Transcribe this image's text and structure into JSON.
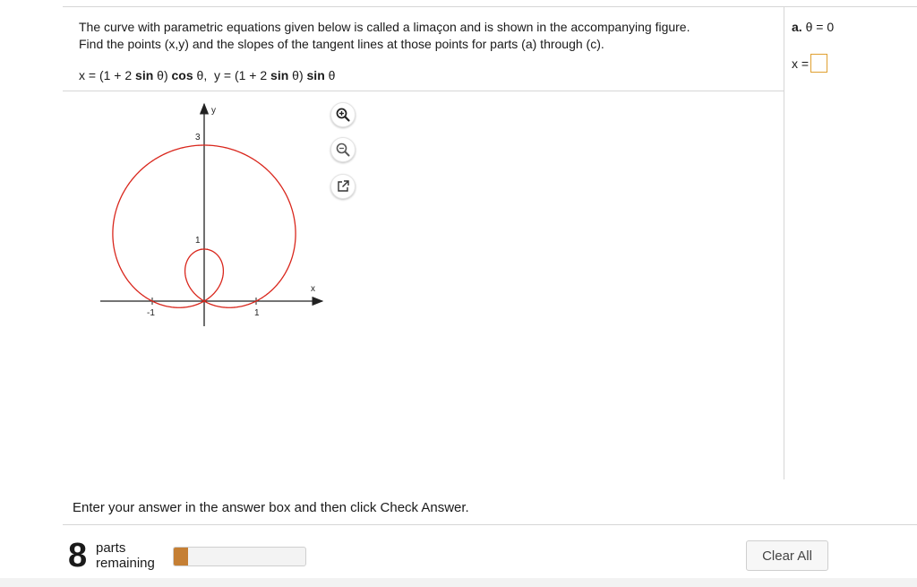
{
  "problem": {
    "line1": "The curve with parametric equations given below is called a limaçon and is shown in the accompanying figure.",
    "line2": "Find the points (x,y) and the slopes of the tangent lines at those points for parts (a) through (c).",
    "eq_x_prefix": "x = (1 + 2 ",
    "eq_x_sin": "sin",
    "eq_x_theta": " θ) ",
    "eq_x_cos": "cos",
    "eq_x_end": " θ,",
    "eq_y_prefix": "y = (1 + 2 ",
    "eq_y_sin": "sin",
    "eq_y_theta": " θ) ",
    "eq_y_sin2": "sin",
    "eq_y_end": " θ"
  },
  "figure": {
    "x_axis_label": "x",
    "y_axis_label": "y",
    "tick_labels": {
      "y3": "3",
      "y1": "1",
      "xneg1": "-1",
      "xpos1": "1"
    },
    "curve_color": "#d9261c",
    "tools": [
      "zoom-in-icon",
      "zoom-out-icon",
      "pop-out-icon"
    ]
  },
  "answer_panel": {
    "part_letter": "a.",
    "part_condition": "θ = 0",
    "x_label": "x ="
  },
  "instruction": "Enter your answer in the answer box and then click Check Answer.",
  "footer": {
    "parts_count": "8",
    "parts_line1": "parts",
    "parts_line2": "remaining",
    "progress_fraction": 0.11,
    "progress_color": "#c57f34",
    "clear_all": "Clear All"
  }
}
